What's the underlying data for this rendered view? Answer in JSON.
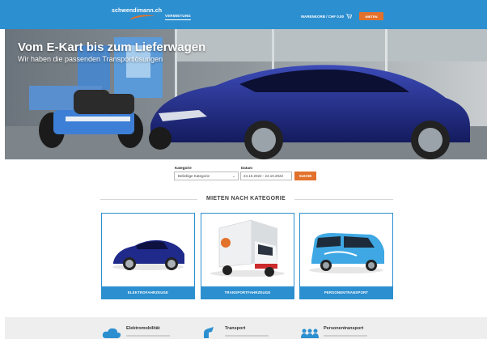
{
  "header": {
    "logo_text": "schwendimann.ch",
    "nav_link": "VERMIETUNG",
    "cart_label": "WARENKORB / CHF 0.00",
    "top_button": "MIETEN"
  },
  "hero": {
    "title": "Vom E-Kart bis zum Lieferwagen",
    "subtitle": "Wir haben die passenden Transportlösungen"
  },
  "search": {
    "category_label": "Kategorie",
    "category_value": "Beliebige Kategorie",
    "date_label": "Datum",
    "date_value": "24.10.2022 - 24.10.2022",
    "button_label": "SUCHE"
  },
  "section": {
    "title": "MIETEN NACH KATEGORIE"
  },
  "categories": [
    {
      "label": "ELEKTROFAHRZEUGE",
      "image": "electric-car-image"
    },
    {
      "label": "TRANSPORTFAHRZEUGE",
      "image": "box-truck-image"
    },
    {
      "label": "PERSONENTRANSPORT",
      "image": "passenger-van-image"
    }
  ],
  "features": [
    {
      "title": "Elektromobilität",
      "icon": "cloud-icon"
    },
    {
      "title": "Transport",
      "icon": "transport-icon"
    },
    {
      "title": "Personentransport",
      "icon": "people-icon"
    }
  ],
  "colors": {
    "brand_blue": "#2c8fd0",
    "accent_orange": "#e2712b",
    "car_blue": "#1f2a8a"
  }
}
